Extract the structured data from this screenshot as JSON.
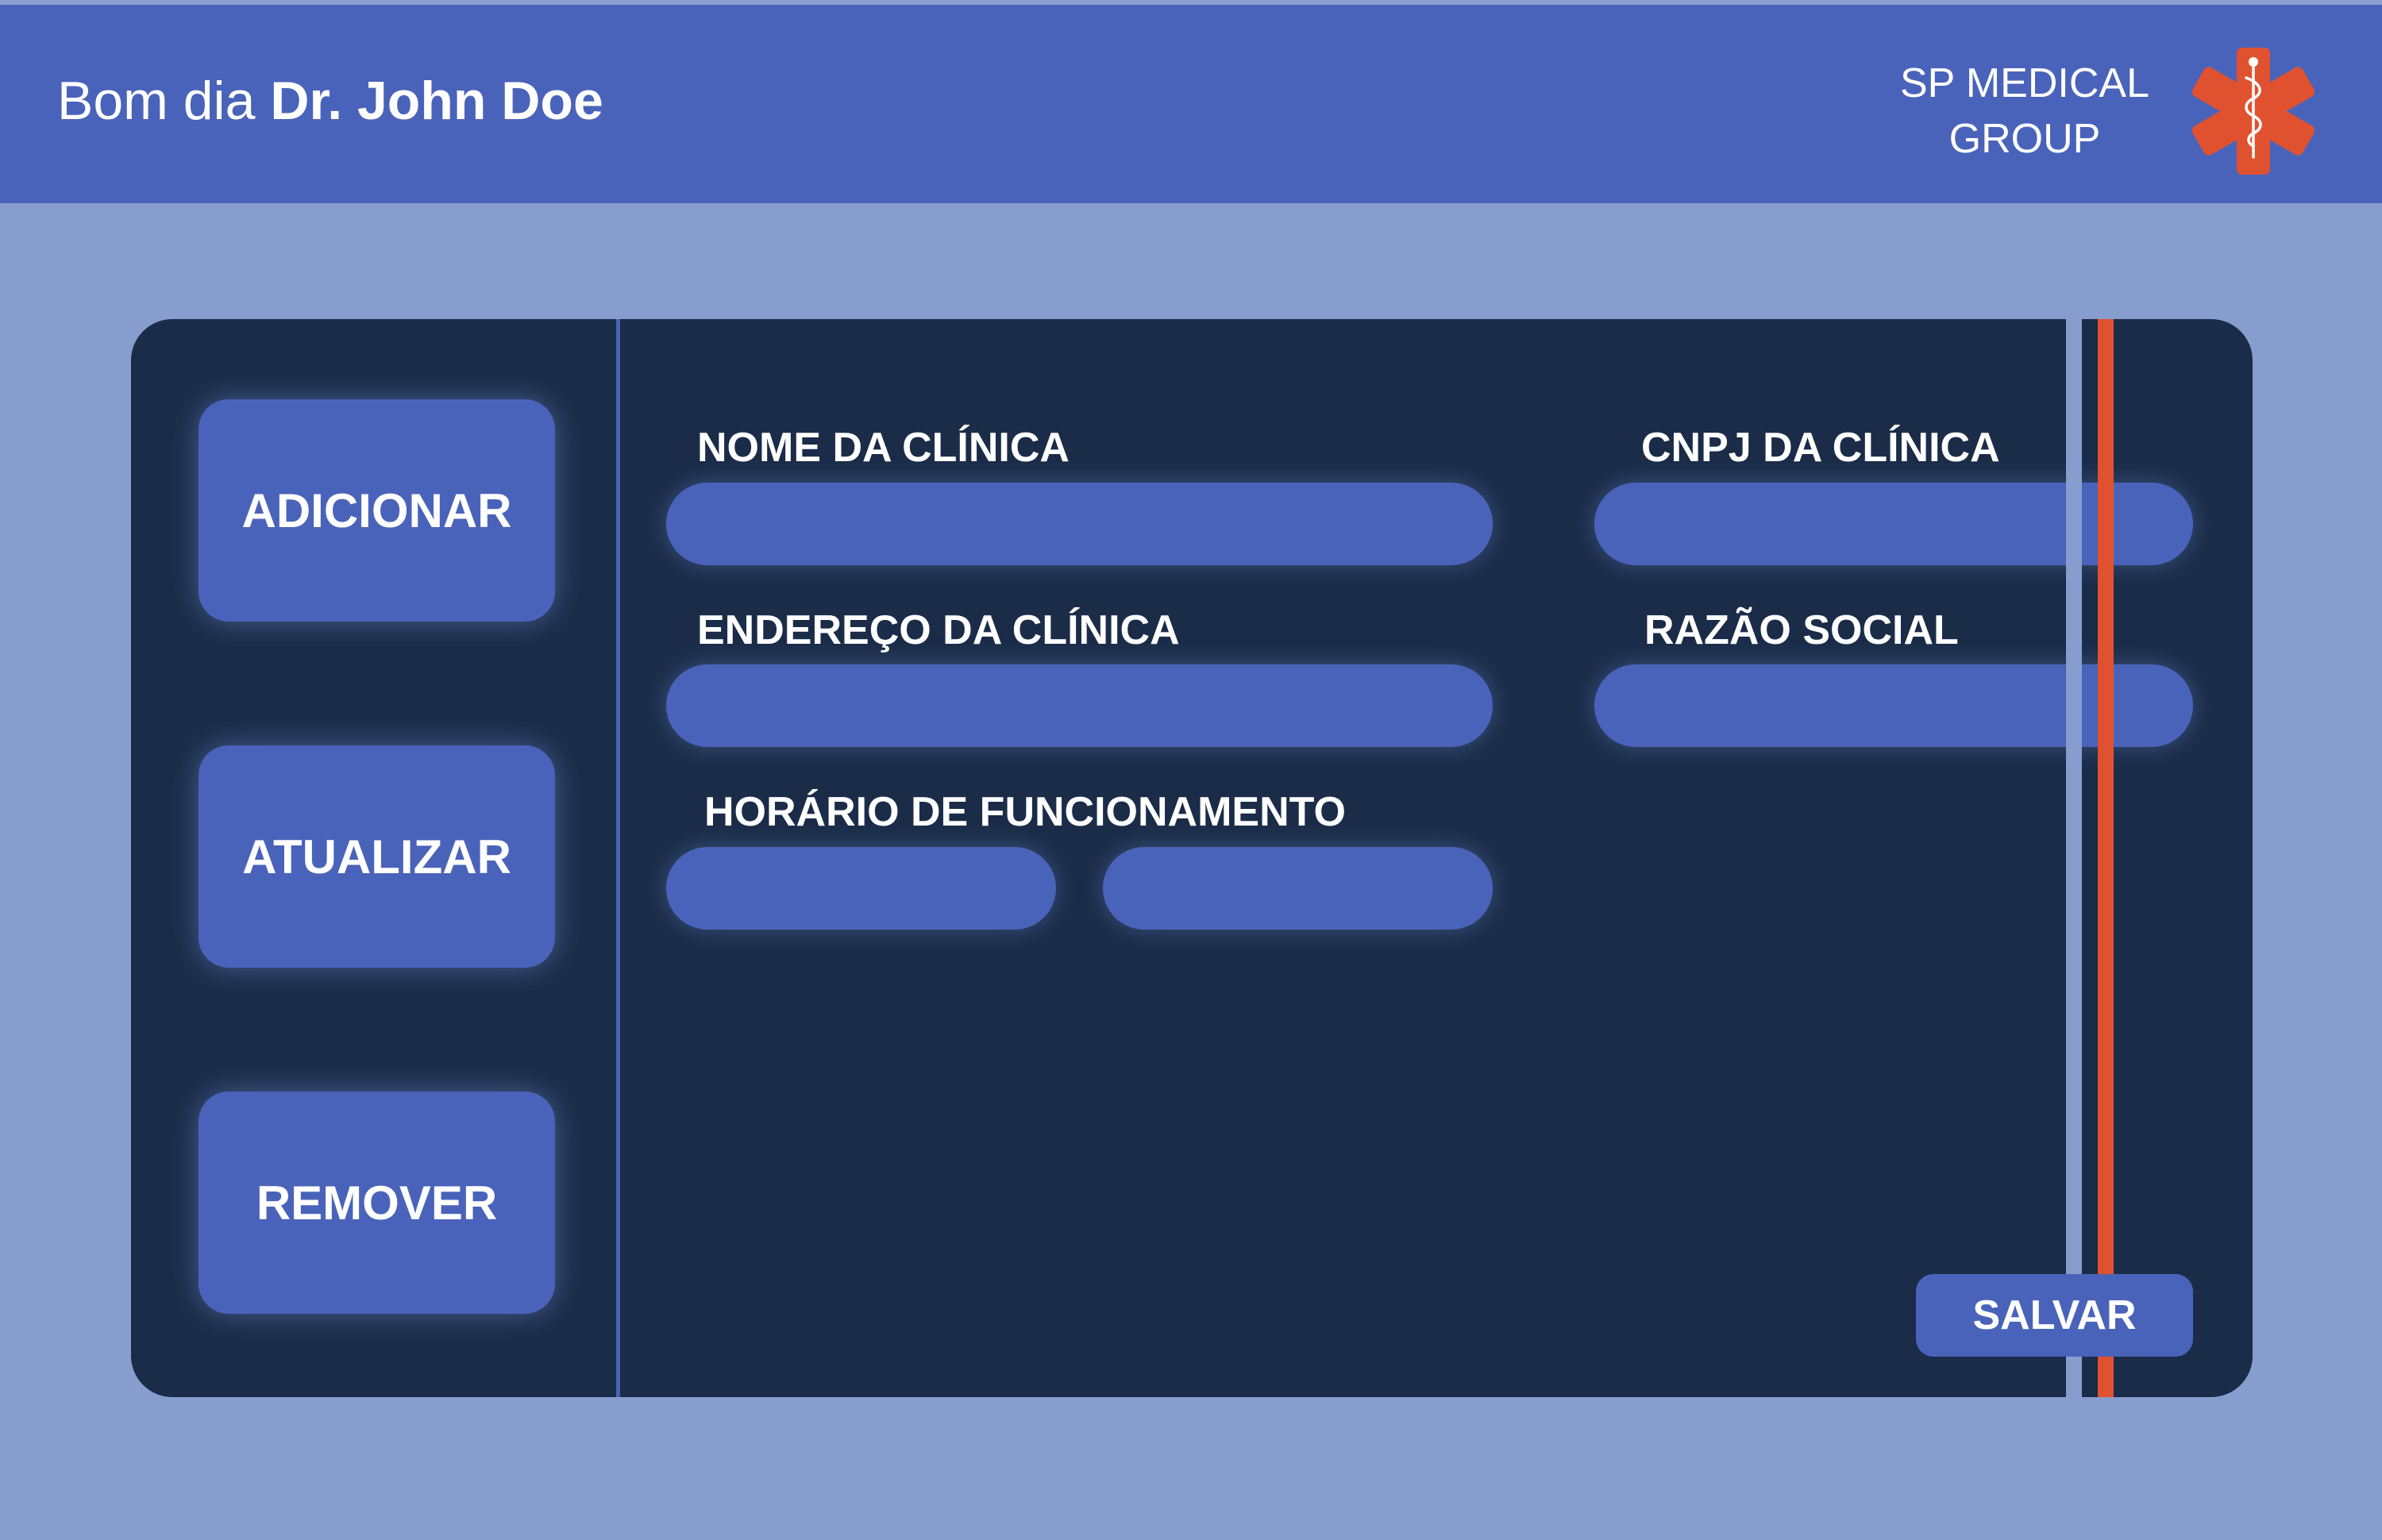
{
  "header": {
    "greeting_prefix": "Bom dia",
    "user_name": "Dr. John Doe",
    "brand_line1": "SP MEDICAL",
    "brand_line2": "GROUP",
    "logo_icon": "star-of-life-icon"
  },
  "sidebar": {
    "add_label": "ADICIONAR",
    "update_label": "ATUALIZAR",
    "remove_label": "REMOVER"
  },
  "form": {
    "clinic_name_label": "NOME DA CLÍNICA",
    "clinic_name_value": "",
    "clinic_cnpj_label": "CNPJ DA CLÍNICA",
    "clinic_cnpj_value": "",
    "clinic_address_label": "ENDEREÇO DA CLÍNICA",
    "clinic_address_value": "",
    "company_name_label": "RAZÃO SOCIAL",
    "company_name_value": "",
    "opening_hours_label": "HORÁRIO DE FUNCIONAMENTO",
    "opening_time_value": "",
    "closing_time_value": "",
    "save_label": "SALVAR"
  },
  "colors": {
    "background": "#879dcd",
    "header": "#4a63ba",
    "panel": "#1a2c48",
    "accent_orange": "#e0522f"
  }
}
